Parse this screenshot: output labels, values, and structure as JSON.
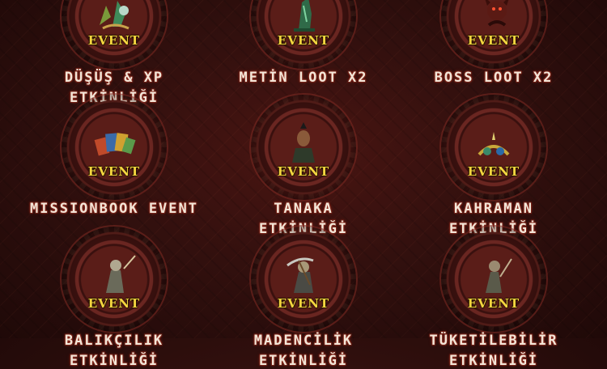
{
  "colors": {
    "background": "#32100e",
    "event_tag": "#f5d640",
    "title": "#f3e6d8",
    "title_glow": "#a13a2a"
  },
  "events": [
    {
      "id": "dusus-xp",
      "tag": "EVENT",
      "multiplier": "",
      "icon": "leaf-dragon-icon",
      "title_line1": "DÜŞÜŞ & XP",
      "title_line2": "ETKİNLİĞİ"
    },
    {
      "id": "metin-loot",
      "tag": "EVENT",
      "multiplier": "x2",
      "icon": "metin-stone-icon",
      "title_line1": "METİN LOOT X2",
      "title_line2": ""
    },
    {
      "id": "boss-loot",
      "tag": "EVENT",
      "multiplier": "x2",
      "icon": "boss-demon-icon",
      "title_line1": "BOSS LOOT X2",
      "title_line2": ""
    },
    {
      "id": "missionbook",
      "tag": "EVENT",
      "multiplier": "",
      "icon": "mission-books-icon",
      "title_line1": "MISSIONBOOK EVENT",
      "title_line2": ""
    },
    {
      "id": "tanaka",
      "tag": "EVENT",
      "multiplier": "",
      "icon": "tanaka-warrior-icon",
      "title_line1": "TANAKA",
      "title_line2": "ETKİNLİĞİ"
    },
    {
      "id": "kahraman",
      "tag": "EVENT",
      "multiplier": "",
      "icon": "hero-items-icon",
      "title_line1": "KAHRAMAN",
      "title_line2": "ETKİNLİĞİ"
    },
    {
      "id": "balikcilik",
      "tag": "EVENT",
      "multiplier": "",
      "icon": "fisherman-icon",
      "title_line1": "BALIKÇILIK",
      "title_line2": "ETKİNLİĞİ"
    },
    {
      "id": "madencilik",
      "tag": "EVENT",
      "multiplier": "",
      "icon": "miner-pickaxe-icon",
      "title_line1": "MADENCİLİK",
      "title_line2": "ETKİNLİĞİ"
    },
    {
      "id": "tuketilebilir",
      "tag": "EVENT",
      "multiplier": "",
      "icon": "consumable-figure-icon",
      "title_line1": "TÜKETİLEBİLİR",
      "title_line2": "ETKİNLİĞİ"
    }
  ]
}
